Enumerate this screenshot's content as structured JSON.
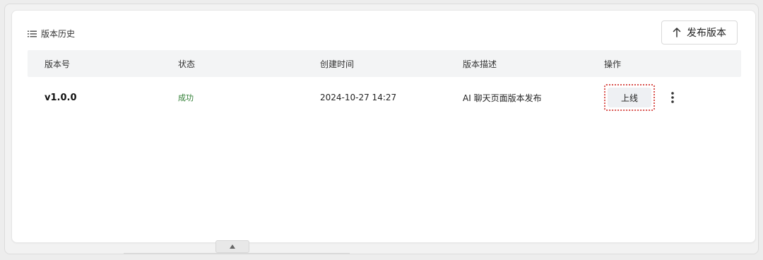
{
  "panel": {
    "title": "版本历史",
    "publish_label": "发布版本",
    "icons": {
      "list": "list-icon",
      "publish": "arrow-up-icon",
      "more": "vertical-ellipsis-icon",
      "scroll": "chevron-up-icon"
    }
  },
  "table": {
    "headers": [
      "版本号",
      "状态",
      "创建时间",
      "版本描述",
      "操作"
    ],
    "rows": [
      {
        "version": "v1.0.0",
        "status": "成功",
        "created_at": "2024-10-27 14:27",
        "description": "AI 聊天页面版本发布",
        "action_label": "上线"
      }
    ]
  },
  "colors": {
    "success": "#2e7d32",
    "header_bg": "#f3f4f5",
    "focus_outline": "#d9534f"
  }
}
